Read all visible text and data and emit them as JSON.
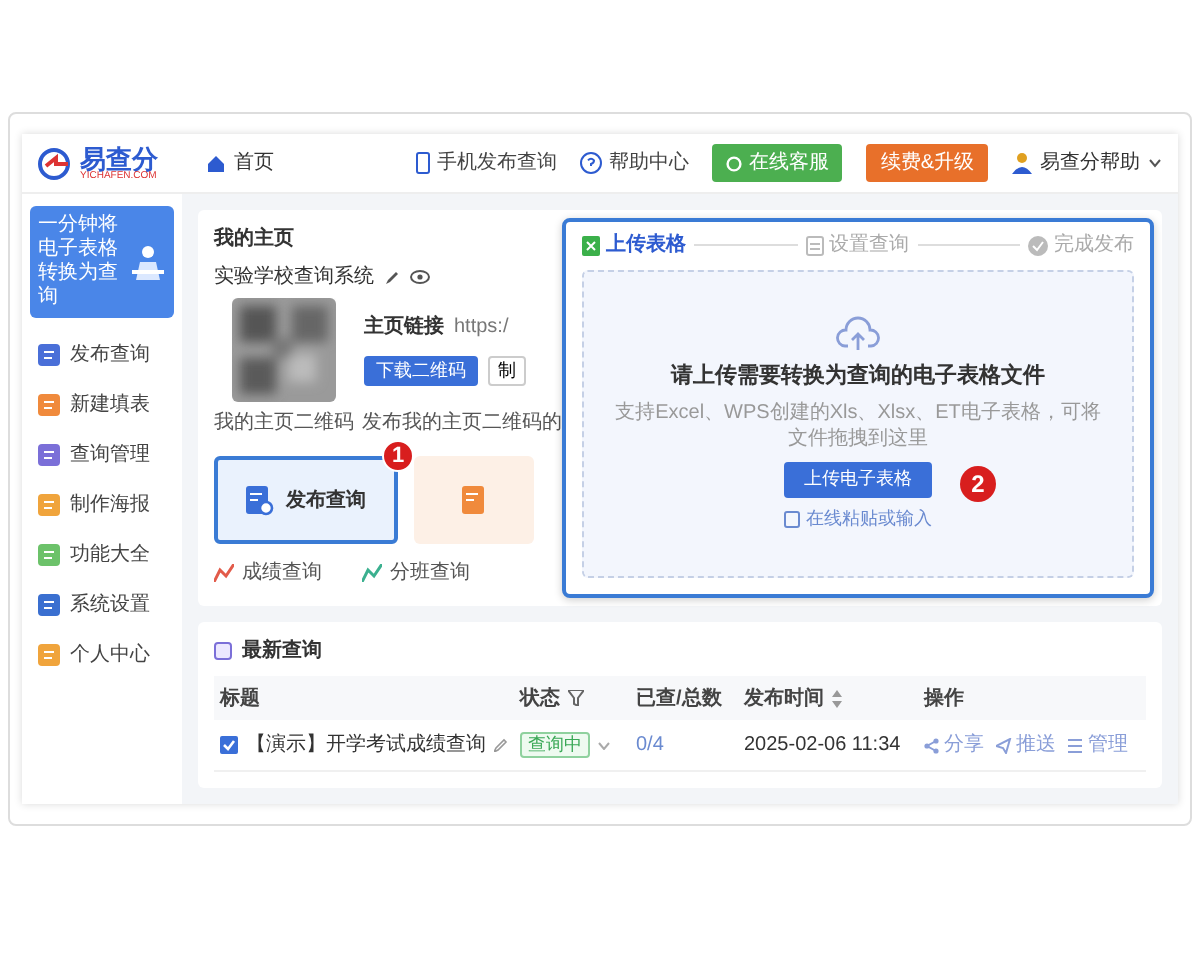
{
  "header": {
    "logo": "易查分",
    "logo_sub": "YICHAFEN.COM",
    "breadcrumb": "首页",
    "links": [
      {
        "kind": "phone",
        "label": "手机发布查询"
      },
      {
        "kind": "help",
        "label": "帮助中心"
      }
    ],
    "buttons": [
      {
        "kind": "chat",
        "label": "在线客服",
        "color": "#4caf50"
      },
      {
        "kind": "plain",
        "label": "续费&升级",
        "color": "#e8702a"
      }
    ],
    "user": "易查分帮助"
  },
  "sidebar": {
    "banner": "一分钟将电子表格转换为查询",
    "items": [
      {
        "label": "发布查询",
        "color": "#4a6fd8"
      },
      {
        "label": "新建填表",
        "color": "#f08a3c"
      },
      {
        "label": "查询管理",
        "color": "#7b6fd8"
      },
      {
        "label": "制作海报",
        "color": "#f0a43c"
      },
      {
        "label": "功能大全",
        "color": "#6cc26a"
      },
      {
        "label": "系统设置",
        "color": "#3a6fd0"
      },
      {
        "label": "个人中心",
        "color": "#f0a43c"
      }
    ]
  },
  "home": {
    "title": "我的主页",
    "site_name": "实验学校查询系统",
    "link_label": "主页链接",
    "link_url": "https:/",
    "download_button": "下载二维码",
    "cut_button": "制",
    "qr_caption": "我的主页二维码",
    "publish_caption": "发布我的主页二维码的"
  },
  "feature_cards": [
    {
      "kind": "publish",
      "label": "发布查询",
      "badge": "1"
    },
    {
      "kind": "form"
    }
  ],
  "quick_links": [
    {
      "label": "成绩查询",
      "color": "#e25b4a"
    },
    {
      "label": "分班查询",
      "color": "#3bb08f"
    }
  ],
  "upload": {
    "steps": [
      {
        "kind": "sheet",
        "label": "上传表格",
        "selected": true
      },
      {
        "kind": "form",
        "label": "设置查询",
        "selected": false
      },
      {
        "kind": "done",
        "label": "完成发布",
        "selected": false
      }
    ],
    "title": "请上传需要转换为查询的电子表格文件",
    "hint": "支持Excel、WPS创建的Xls、Xlsx、ET电子表格，可将文件拖拽到这里",
    "button": "上传电子表格",
    "badge": "2",
    "paste_link": "在线粘贴或输入"
  },
  "latest": {
    "title": "最新查询",
    "columns": [
      {
        "label": "标题",
        "kind": "plain"
      },
      {
        "label": "状态",
        "kind": "filter"
      },
      {
        "label": "已查/总数",
        "kind": "plain"
      },
      {
        "label": "发布时间",
        "kind": "sort"
      },
      {
        "label": "操作",
        "kind": "plain"
      }
    ],
    "rows": [
      {
        "checked": true,
        "title": "【演示】开学考试成绩查询",
        "status": "查询中",
        "count": "0/4",
        "time": "2025-02-06 11:34",
        "actions": [
          "分享",
          "推送",
          "管理"
        ]
      }
    ]
  }
}
